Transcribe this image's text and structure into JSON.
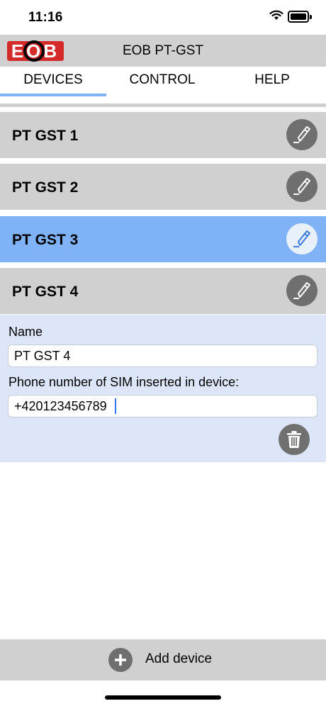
{
  "status_bar": {
    "time": "11:16",
    "wifi_icon": "wifi-icon",
    "battery_icon": "battery-icon"
  },
  "header": {
    "logo_text": "EOB",
    "title": "EOB PT-GST",
    "accent_color": "#d42a2a"
  },
  "tabs": [
    {
      "label": "DEVICES",
      "active": true
    },
    {
      "label": "CONTROL",
      "active": false
    },
    {
      "label": "HELP",
      "active": false
    }
  ],
  "devices": [
    {
      "name": "PT GST 1",
      "selected": false
    },
    {
      "name": "PT GST 2",
      "selected": false
    },
    {
      "name": "PT GST 3",
      "selected": true
    },
    {
      "name": "PT GST 4",
      "selected": false
    }
  ],
  "details": {
    "name_label": "Name",
    "name_value": "PT GST 4",
    "phone_label": "Phone number of SIM inserted in device:",
    "phone_value": "+420123456789"
  },
  "footer": {
    "add_label": "Add device",
    "add_icon": "plus-icon"
  },
  "colors": {
    "bar_gray": "#d0d0d0",
    "selected_blue": "#80b2f8",
    "panel_blue": "#dce6f8"
  }
}
